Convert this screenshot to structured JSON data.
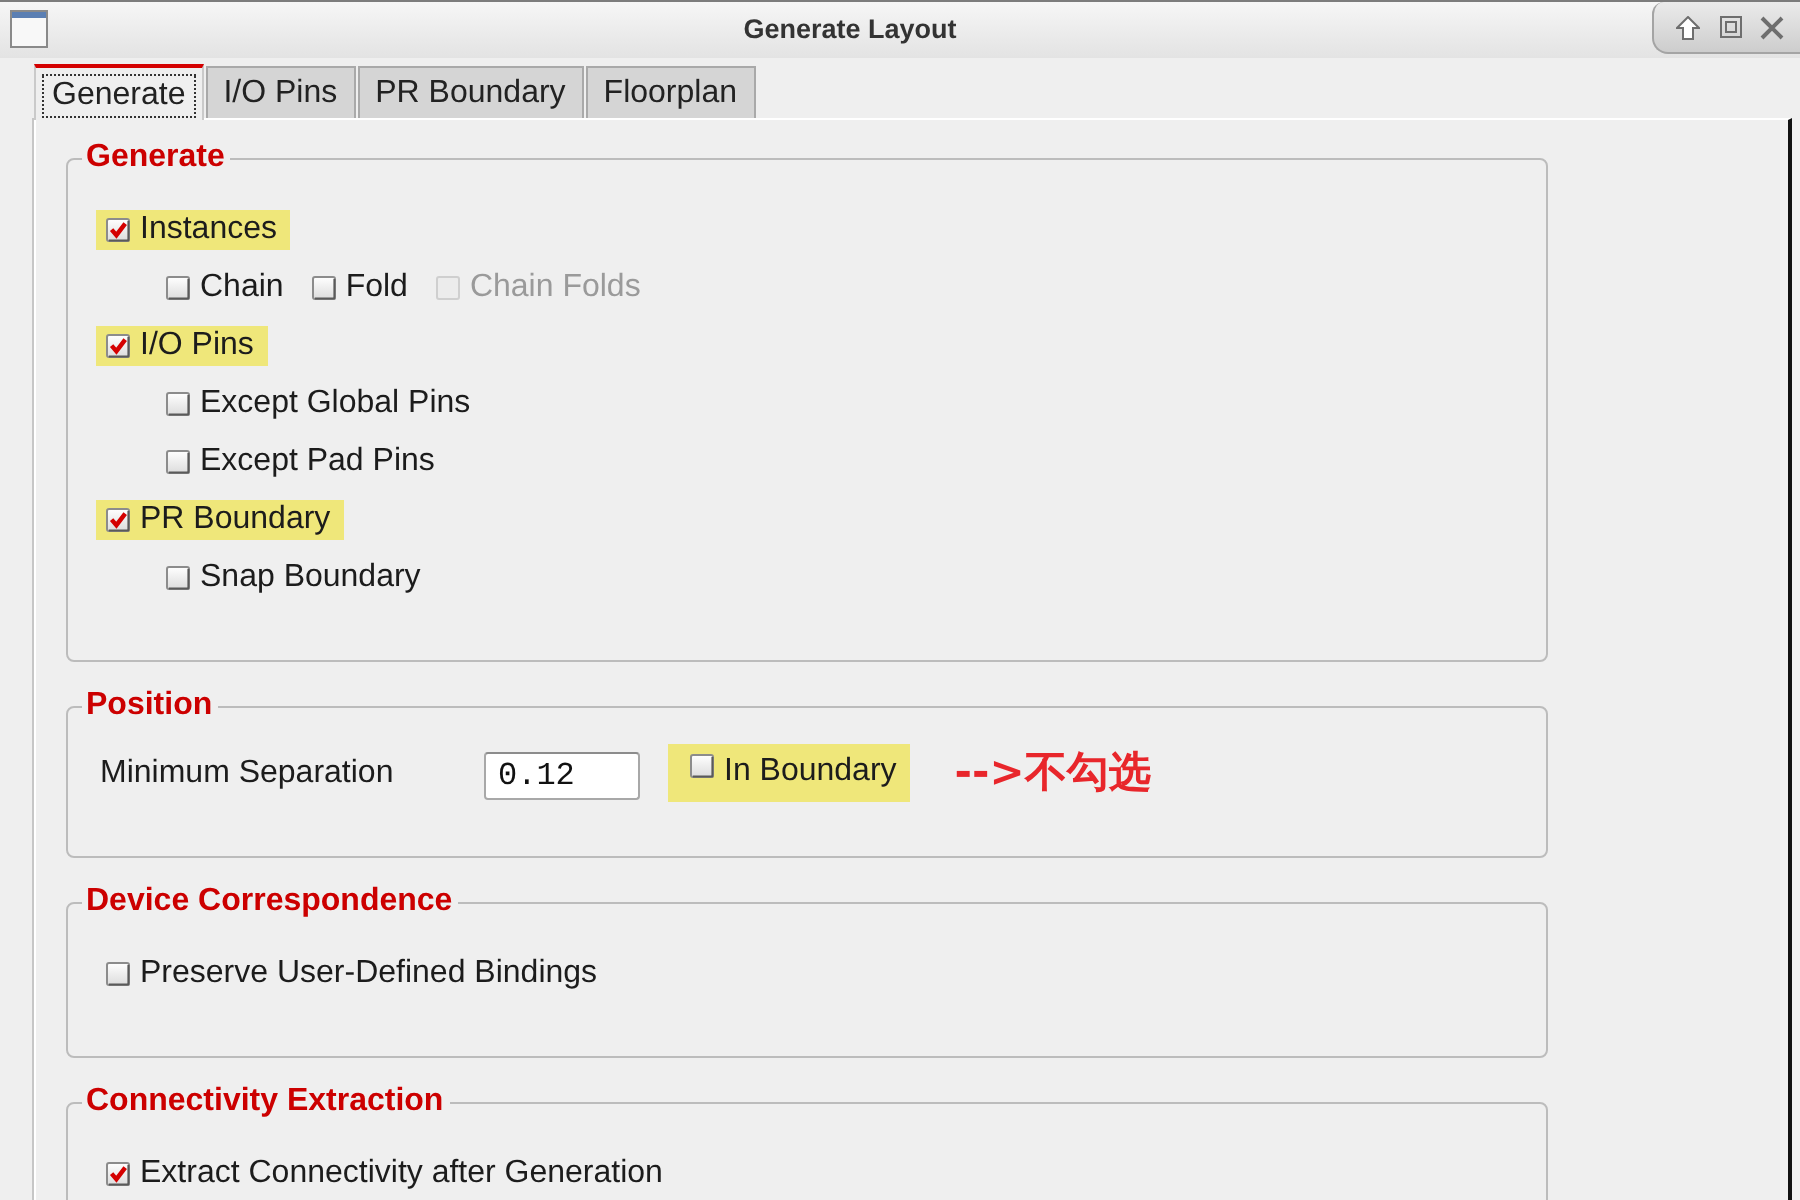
{
  "window": {
    "title": "Generate Layout"
  },
  "tabs": [
    {
      "label": "Generate",
      "selected": true
    },
    {
      "label": "I/O Pins",
      "selected": false
    },
    {
      "label": "PR Boundary",
      "selected": false
    },
    {
      "label": "Floorplan",
      "selected": false
    }
  ],
  "groups": [
    {
      "title": "Generate",
      "horizontal": false,
      "items": [
        {
          "kind": "checkbox",
          "label": "Instances",
          "checked": true,
          "disabled": false,
          "highlighted": true,
          "children_inline": true,
          "children": [
            {
              "kind": "checkbox",
              "label": "Chain",
              "checked": false,
              "disabled": false,
              "highlighted": false
            },
            {
              "kind": "checkbox",
              "label": "Fold",
              "checked": false,
              "disabled": false,
              "highlighted": false
            },
            {
              "kind": "checkbox",
              "label": "Chain Folds",
              "checked": false,
              "disabled": true,
              "highlighted": false
            }
          ]
        },
        {
          "kind": "checkbox",
          "label": "I/O Pins",
          "checked": true,
          "disabled": false,
          "highlighted": true,
          "children_inline": false,
          "children": [
            {
              "kind": "checkbox",
              "label": "Except Global Pins",
              "checked": false,
              "disabled": false,
              "highlighted": false
            },
            {
              "kind": "checkbox",
              "label": "Except Pad Pins",
              "checked": false,
              "disabled": false,
              "highlighted": false
            }
          ]
        },
        {
          "kind": "checkbox",
          "label": "PR Boundary",
          "checked": true,
          "disabled": false,
          "highlighted": true,
          "children_inline": false,
          "children": [
            {
              "kind": "checkbox",
              "label": "Snap Boundary",
              "checked": false,
              "disabled": false,
              "highlighted": false
            }
          ]
        }
      ]
    },
    {
      "title": "Position",
      "horizontal": true,
      "items": [
        {
          "kind": "field",
          "label": "Minimum Separation",
          "value": "0.12"
        },
        {
          "kind": "checkbox",
          "label": "In Boundary",
          "checked": false,
          "disabled": false,
          "highlighted": true
        },
        {
          "kind": "note",
          "text": "-->不勾选"
        }
      ]
    },
    {
      "title": "Device Correspondence",
      "horizontal": false,
      "items": [
        {
          "kind": "checkbox",
          "label": "Preserve User-Defined Bindings",
          "checked": false,
          "disabled": false,
          "highlighted": false
        }
      ]
    },
    {
      "title": "Connectivity Extraction",
      "horizontal": false,
      "items": [
        {
          "kind": "checkbox",
          "label": "Extract Connectivity after Generation",
          "checked": true,
          "disabled": false,
          "highlighted": false
        }
      ]
    }
  ]
}
